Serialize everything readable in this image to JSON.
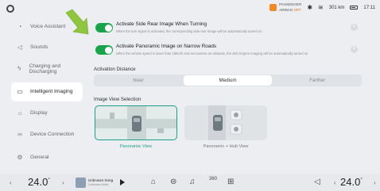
{
  "status": {
    "airbag_label": "PASSENGER",
    "airbag_prefix": "AIRBAG",
    "airbag_state": "OFF",
    "range": "301 km",
    "time": "17:11"
  },
  "sidebar": {
    "items": [
      {
        "label": "Voice Assistant",
        "icon": "voice-icon",
        "glyph": "◔"
      },
      {
        "label": "Sounds",
        "icon": "speaker-icon",
        "glyph": "◁"
      },
      {
        "label": "Charging and Discharging",
        "icon": "plug-icon",
        "glyph": "ϟ"
      },
      {
        "label": "Intelligent Imaging",
        "icon": "camera-icon",
        "glyph": "▭"
      },
      {
        "label": "Display",
        "icon": "brightness-icon",
        "glyph": "☼"
      },
      {
        "label": "Device Connection",
        "icon": "link-icon",
        "glyph": "∞"
      },
      {
        "label": "General",
        "icon": "gear-icon",
        "glyph": "⚙"
      }
    ],
    "active_index": 3
  },
  "settings": {
    "side_rear": {
      "title": "Activate Side Rear Image When Turning",
      "description": "When the turn signal is activated, the corresponding side rear image will be automatically turned on",
      "enabled": true
    },
    "narrow_roads": {
      "title": "Activate Panoramic Image on Narrow Roads",
      "description": "When the vehicle speed is lower than 15km/h and encounters an obstacle, the 360 Degree Imaging will be automatically turned on",
      "enabled": true
    },
    "activation_distance": {
      "label": "Activation Distance",
      "options": [
        "Near",
        "Medium",
        "Farther"
      ],
      "selected": "Medium"
    },
    "image_view": {
      "label": "Image View Selection",
      "options": [
        "Panoramic View",
        "Panoramic + Hub View"
      ],
      "selected": "Panoramic View"
    }
  },
  "dock": {
    "left_temp": "24.0",
    "right_temp": "24.0",
    "degree": "°",
    "song_title": "Unknown Song",
    "song_artist": "Unknown Artist",
    "camera_label": "360",
    "accent": "#1aa08a",
    "toggle_color": "#18a54a"
  }
}
